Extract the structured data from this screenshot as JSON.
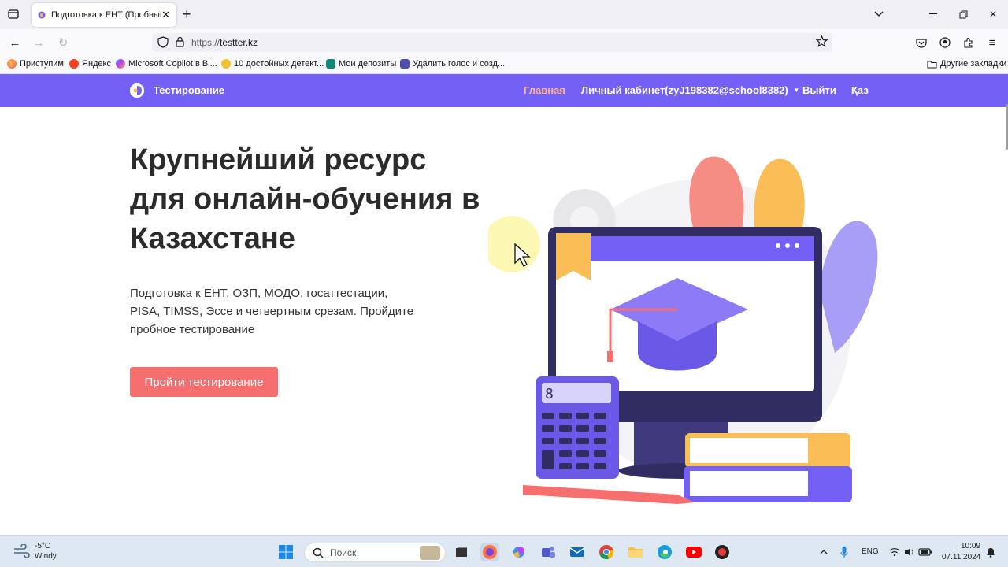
{
  "browser": {
    "tab_title": "Подготовка к ЕНТ (Пробный",
    "url_scheme": "https://",
    "url_host": "testter.kz"
  },
  "bookmarks": {
    "items": [
      "Приступим",
      "Яндекс",
      "Microsoft Copilot в Bi...",
      "10 достойных детект...",
      "Мои депозиты",
      "Удалить голос и созд..."
    ],
    "other": "Другие закладки"
  },
  "site": {
    "brand": "Тестирование",
    "nav": {
      "home": "Главная",
      "account": "Личный кабинет(zyJ198382@school8382)",
      "logout": "Выйти",
      "lang": "Қаз"
    }
  },
  "hero": {
    "title_line1": "Крупнейший ресурс",
    "title_line2": "для онлайн-обучения в",
    "title_line3": "Казахстане",
    "subtitle_line1": "Подготовка к ЕНТ, ОЗП, МОДО, госаттестации,",
    "subtitle_line2": "PISA, TIMSS, Эссе и четвертным срезам. Пройдите",
    "subtitle_line3": "пробное тестирование",
    "cta": "Пройти тестирование",
    "calculator_display": "8"
  },
  "taskbar": {
    "weather_temp": "-5°C",
    "weather_desc": "Windy",
    "search_placeholder": "Поиск",
    "lang": "ENG",
    "time": "10:09",
    "date": "07.11.2024"
  },
  "colors": {
    "header_bg": "#7361f6",
    "nav_active": "#ffb38a",
    "cta_bg": "#f76e6e"
  }
}
